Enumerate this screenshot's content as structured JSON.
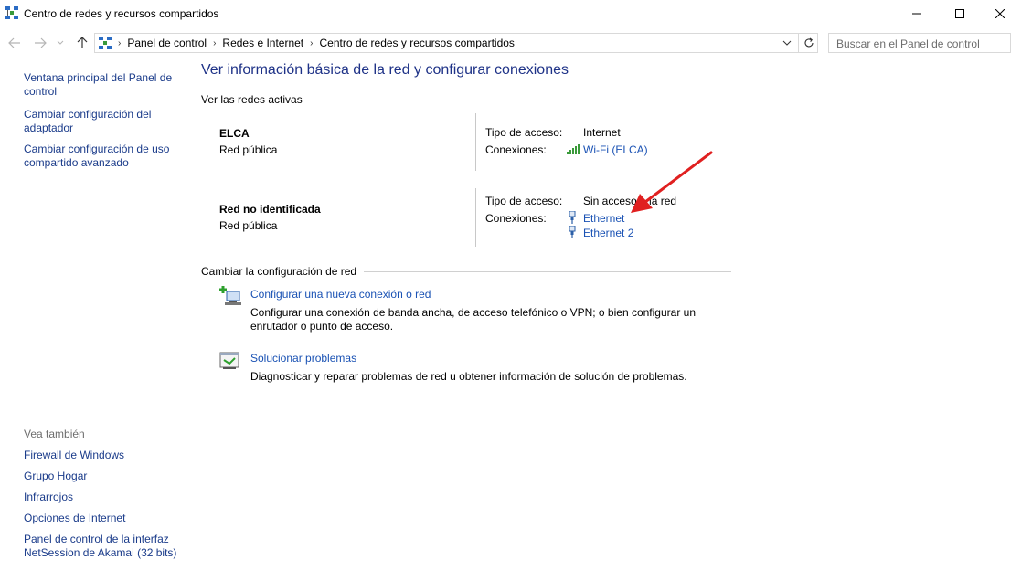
{
  "window": {
    "title": "Centro de redes y recursos compartidos"
  },
  "address": {
    "crumbs": [
      "Panel de control",
      "Redes e Internet",
      "Centro de redes y recursos compartidos"
    ]
  },
  "search": {
    "placeholder": "Buscar en el Panel de control"
  },
  "sidebar": {
    "links": [
      "Ventana principal del Panel de control",
      "Cambiar configuración del adaptador",
      "Cambiar configuración de uso compartido avanzado"
    ],
    "see_also_header": "Vea también",
    "see_also": [
      "Firewall de Windows",
      "Grupo Hogar",
      "Infrarrojos",
      "Opciones de Internet",
      "Panel de control de la interfaz NetSession de Akamai (32 bits)"
    ]
  },
  "main": {
    "title": "Ver información básica de la red y configurar conexiones",
    "active_networks_header": "Ver las redes activas",
    "networks": [
      {
        "name": "ELCA",
        "type": "Red pública",
        "access_label": "Tipo de acceso:",
        "access_value": "Internet",
        "connections_label": "Conexiones:",
        "connections": [
          "Wi-Fi (ELCA)"
        ]
      },
      {
        "name": "Red no identificada",
        "type": "Red pública",
        "access_label": "Tipo de acceso:",
        "access_value": "Sin acceso a la red",
        "connections_label": "Conexiones:",
        "connections": [
          "Ethernet",
          "Ethernet 2"
        ]
      }
    ],
    "change_settings_header": "Cambiar la configuración de red",
    "tasks": [
      {
        "link": "Configurar una nueva conexión o red",
        "description": "Configurar una conexión de banda ancha, de acceso telefónico o VPN; o bien configurar un enrutador o punto de acceso."
      },
      {
        "link": "Solucionar problemas",
        "description": "Diagnosticar y reparar problemas de red u obtener información de solución de problemas."
      }
    ]
  },
  "colors": {
    "link": "#1a52b4",
    "title": "#1e3287",
    "annotation_arrow": "#e02020"
  },
  "icons": {
    "app": "network-center-icon",
    "wifi": "wifi-signal-icon",
    "ethernet": "ethernet-icon",
    "new_connection": "new-connection-icon",
    "troubleshoot": "troubleshoot-icon"
  }
}
